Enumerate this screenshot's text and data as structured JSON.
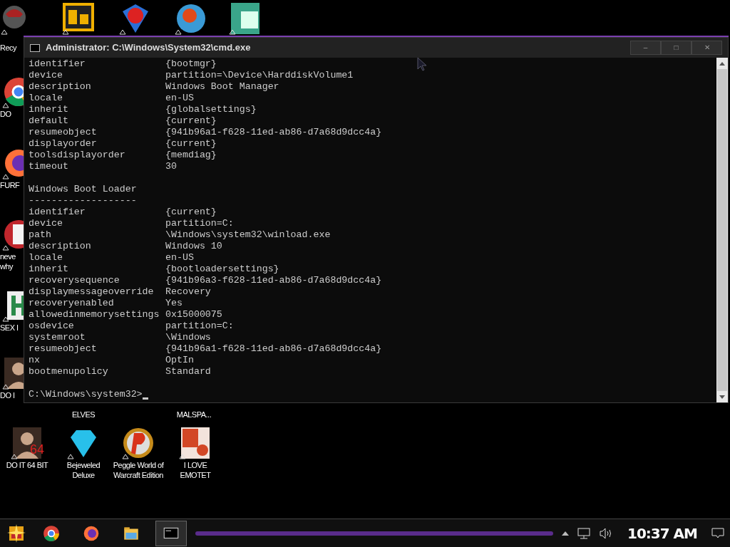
{
  "desktop_icons": [
    {
      "kind": "helmet",
      "label": "Recy"
    },
    {
      "kind": "de"
    },
    {
      "kind": "gem2"
    },
    {
      "kind": "peggle-blue"
    },
    {
      "kind": "publisher"
    },
    {
      "kind": "chrome",
      "label": "DO"
    },
    {
      "kind": "firefox",
      "label": "FURF"
    },
    {
      "kind": "dc",
      "label": "neve why"
    },
    {
      "kind": "h",
      "label": "SEX I"
    },
    {
      "kind": "portrait",
      "label": "DO I"
    },
    {
      "kind": "none",
      "label": "ELVES"
    },
    {
      "kind": "none",
      "label": "MALSPA..."
    },
    {
      "kind": "portrait",
      "label": "DO IT 64 BIT",
      "badge": "64"
    },
    {
      "kind": "diamond",
      "label": "Bejeweled Deluxe"
    },
    {
      "kind": "peggle",
      "label": "Peggle World of Warcraft Edition"
    },
    {
      "kind": "powerpoint",
      "label": "I LOVE EMOTET"
    }
  ],
  "window": {
    "title": "Administrator: C:\\Windows\\System32\\cmd.exe",
    "buttons": [
      "–",
      "□",
      "✕"
    ],
    "lines": [
      {
        "kind": "pair",
        "key": "identifier",
        "value": "{bootmgr}"
      },
      {
        "kind": "pair",
        "key": "device",
        "value": "partition=\\Device\\HarddiskVolume1"
      },
      {
        "kind": "pair",
        "key": "description",
        "value": "Windows Boot Manager"
      },
      {
        "kind": "pair",
        "key": "locale",
        "value": "en-US"
      },
      {
        "kind": "pair",
        "key": "inherit",
        "value": "{globalsettings}"
      },
      {
        "kind": "pair",
        "key": "default",
        "value": "{current}"
      },
      {
        "kind": "pair",
        "key": "resumeobject",
        "value": "{941b96a1-f628-11ed-ab86-d7a68d9dcc4a}"
      },
      {
        "kind": "pair",
        "key": "displayorder",
        "value": "{current}"
      },
      {
        "kind": "pair",
        "key": "toolsdisplayorder",
        "value": "{memdiag}"
      },
      {
        "kind": "pair",
        "key": "timeout",
        "value": "30"
      },
      {
        "kind": "blank"
      },
      {
        "kind": "text",
        "text": "Windows Boot Loader"
      },
      {
        "kind": "text",
        "text": "-------------------"
      },
      {
        "kind": "pair",
        "key": "identifier",
        "value": "{current}"
      },
      {
        "kind": "pair",
        "key": "device",
        "value": "partition=C:"
      },
      {
        "kind": "pair",
        "key": "path",
        "value": "\\Windows\\system32\\winload.exe"
      },
      {
        "kind": "pair",
        "key": "description",
        "value": "Windows 10"
      },
      {
        "kind": "pair",
        "key": "locale",
        "value": "en-US"
      },
      {
        "kind": "pair",
        "key": "inherit",
        "value": "{bootloadersettings}"
      },
      {
        "kind": "pair",
        "key": "recoverysequence",
        "value": "{941b96a3-f628-11ed-ab86-d7a68d9dcc4a}"
      },
      {
        "kind": "pair",
        "key": "displaymessageoverride",
        "value": "Recovery"
      },
      {
        "kind": "pair",
        "key": "recoveryenabled",
        "value": "Yes"
      },
      {
        "kind": "pair",
        "key": "allowedinmemorysettings",
        "value": "0x15000075"
      },
      {
        "kind": "pair",
        "key": "osdevice",
        "value": "partition=C:"
      },
      {
        "kind": "pair",
        "key": "systemroot",
        "value": "\\Windows"
      },
      {
        "kind": "pair",
        "key": "resumeobject",
        "value": "{941b96a1-f628-11ed-ab86-d7a68d9dcc4a}"
      },
      {
        "kind": "pair",
        "key": "nx",
        "value": "OptIn"
      },
      {
        "kind": "pair",
        "key": "bootmenupolicy",
        "value": "Standard"
      },
      {
        "kind": "blank"
      },
      {
        "kind": "prompt",
        "text": "C:\\Windows\\system32>"
      }
    ]
  },
  "taskbar": {
    "apps": [
      {
        "kind": "chrome",
        "selected": false
      },
      {
        "kind": "firefox",
        "selected": false
      },
      {
        "kind": "folder",
        "selected": false
      },
      {
        "kind": "console",
        "selected": true
      }
    ],
    "clock": "10:37 AM"
  }
}
